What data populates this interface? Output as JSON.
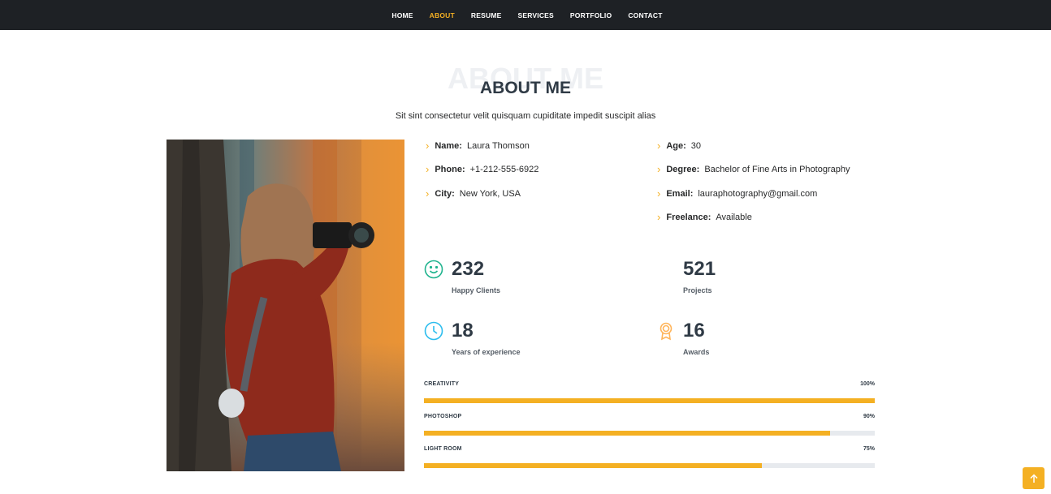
{
  "nav": {
    "items": [
      {
        "label": "HOME",
        "active": false
      },
      {
        "label": "ABOUT",
        "active": true
      },
      {
        "label": "RESUME",
        "active": false
      },
      {
        "label": "SERVICES",
        "active": false
      },
      {
        "label": "PORTFOLIO",
        "active": false
      },
      {
        "label": "CONTACT",
        "active": false
      }
    ]
  },
  "section": {
    "ghost_title": "ABOUT ME",
    "title": "ABOUT ME",
    "subtitle": "Sit sint consectetur velit quisquam cupiditate impedit suscipit alias"
  },
  "info": {
    "left": [
      {
        "key": "Name:",
        "value": "Laura Thomson"
      },
      {
        "key": "Phone:",
        "value": "+1-212-555-6922"
      },
      {
        "key": "City:",
        "value": "New York, USA"
      }
    ],
    "right": [
      {
        "key": "Age:",
        "value": "30"
      },
      {
        "key": "Degree:",
        "value": "Bachelor of Fine Arts in Photography"
      },
      {
        "key": "Email:",
        "value": "lauraphotography@gmail.com"
      },
      {
        "key": "Freelance:",
        "value": "Available"
      }
    ]
  },
  "stats": [
    {
      "icon": "smile-icon",
      "number": "232",
      "label": "Happy Clients",
      "color": "#20b38e"
    },
    {
      "icon": "journal-icon",
      "number": "521",
      "label": "Projects",
      "color": "#8a1ac2"
    },
    {
      "icon": "clock-icon",
      "number": "18",
      "label": "Years of experience",
      "color": "#2cbdee"
    },
    {
      "icon": "award-icon",
      "number": "16",
      "label": "Awards",
      "color": "#ffb459"
    }
  ],
  "skills": [
    {
      "name": "CREATIVITY",
      "value_label": "100%",
      "percent": 100
    },
    {
      "name": "PHOTOSHOP",
      "value_label": "90%",
      "percent": 90
    },
    {
      "name": "LIGHT ROOM",
      "value_label": "75%",
      "percent": 75
    }
  ],
  "colors": {
    "accent": "#f4b023",
    "nav_bg": "#1e2125",
    "heading": "#2f3a45"
  },
  "back_to_top": {
    "icon": "arrow-up-icon"
  }
}
